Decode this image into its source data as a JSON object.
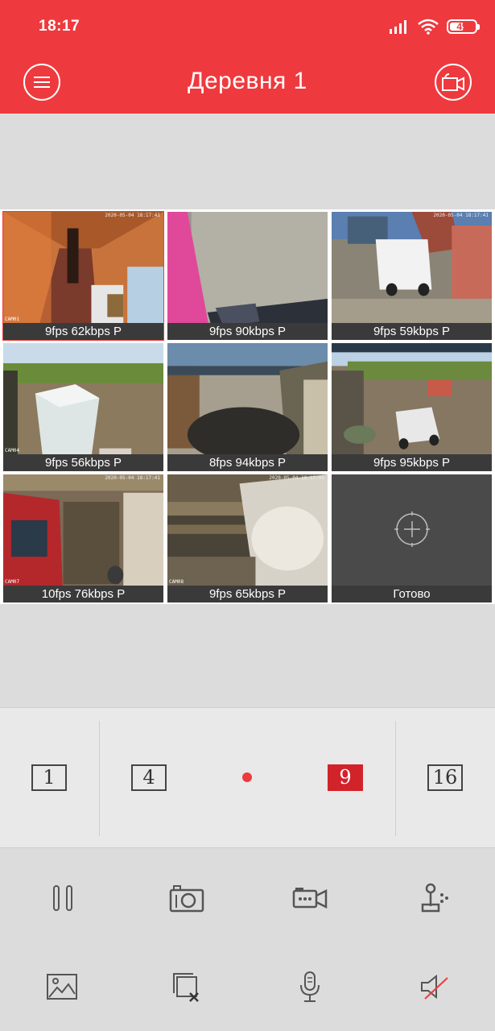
{
  "status_bar": {
    "time": "18:17",
    "battery": "49"
  },
  "header": {
    "title": "Деревня 1",
    "menu_icon": "menu-icon",
    "record_icon": "video-record-icon"
  },
  "cameras": [
    {
      "caption": "9fps 62kbps P",
      "stamp": "2020-05-04 18:17:41",
      "label": "CAM01",
      "selected": true
    },
    {
      "caption": "9fps 90kbps P",
      "stamp": "",
      "label": ""
    },
    {
      "caption": "9fps 59kbps P",
      "stamp": "2020-05-04 18:17:41",
      "label": ""
    },
    {
      "caption": "9fps 56kbps P",
      "stamp": "",
      "label": "CAM04"
    },
    {
      "caption": "8fps 94kbps P",
      "stamp": "",
      "label": ""
    },
    {
      "caption": "9fps 95kbps P",
      "stamp": "",
      "label": ""
    },
    {
      "caption": "10fps 76kbps P",
      "stamp": "2020-05-04 18:17:41",
      "label": "CAM07"
    },
    {
      "caption": "9fps 65kbps P",
      "stamp": "2020-05-04 18:17:41",
      "label": "CAM08"
    }
  ],
  "add_cell": {
    "label": "Готово",
    "icon": "add-circle-icon"
  },
  "split_options": [
    "1",
    "4",
    "9",
    "16"
  ],
  "split_active": "9",
  "tools": {
    "row1": [
      "pause-icon",
      "camera-snapshot-icon",
      "record-video-icon",
      "ptz-joystick-icon"
    ],
    "row2": [
      "gallery-image-icon",
      "close-all-icon",
      "microphone-icon",
      "speaker-muted-icon"
    ]
  },
  "colors": {
    "accent": "#ee3a3e",
    "active_split": "#d2232a",
    "caption_bg": "#3a3a3a"
  }
}
